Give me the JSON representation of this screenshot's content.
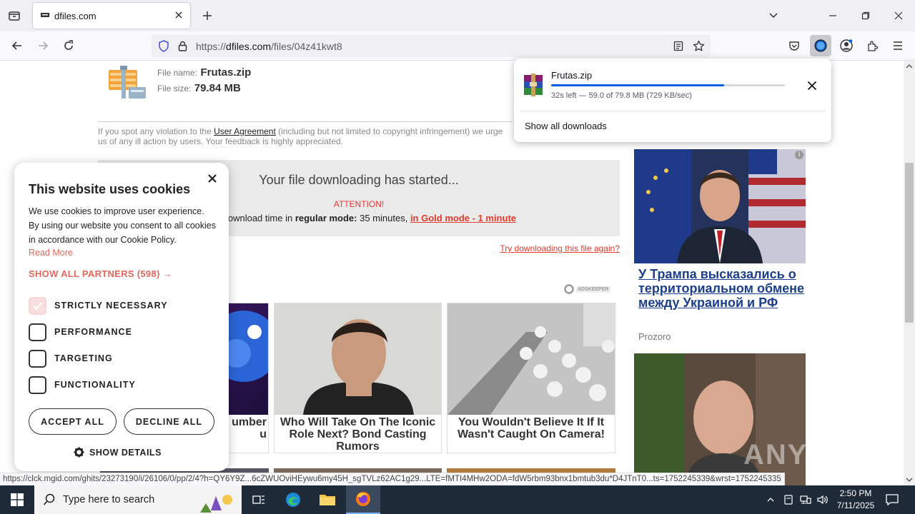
{
  "browser": {
    "tab_title": "dfiles.com",
    "url_prefix": "https://",
    "url_host": "dfiles.com",
    "url_path": "/files/04z41kwt8"
  },
  "file": {
    "name_label": "File name:",
    "name": "Frutas.zip",
    "size_label": "File size:",
    "size": "79.84 MB"
  },
  "violation": {
    "text_before": "If you spot any violation to the ",
    "link": "User Agreement",
    "text_after": " (including but not limited to copyright infringement) we urge",
    "line2": "us of any ill action by users. Your feedback is highly appreciated."
  },
  "download_box": {
    "heading": "Your file downloading has started...",
    "attention": "ATTENTION!",
    "avg_prefix": "rage download time in ",
    "mode": "regular mode:",
    "avg_time": " 35 minutes, ",
    "gold_link": "in Gold mode - 1 minute"
  },
  "retry_link": "Try downloading this file again?",
  "adskeeper": "ADSKEEPER",
  "ads": [
    {
      "caption": "umber\nu"
    },
    {
      "caption": "Who Will Take On The Iconic Role Next? Bond Casting Rumors"
    },
    {
      "caption": "You Wouldn't Believe It If It Wasn't Caught On Camera!"
    }
  ],
  "news": {
    "title": "У Трампа высказались о территориальном обмене между Украиной и РФ",
    "source": "Prozoro"
  },
  "cookie": {
    "title": "This website uses cookies",
    "description": "We use cookies to improve user experience. By using our website you consent to all cookies in accordance with our Cookie Policy.",
    "read_more": "Read More",
    "partners": "SHOW ALL PARTNERS (598) →",
    "options": [
      "STRICTLY NECESSARY",
      "PERFORMANCE",
      "TARGETING",
      "FUNCTIONALITY"
    ],
    "accept": "ACCEPT ALL",
    "decline": "DECLINE ALL",
    "details": "SHOW DETAILS"
  },
  "downloads_panel": {
    "filename": "Frutas.zip",
    "status": "32s left — 59.0 of 79.8 MB (729 KB/sec)",
    "progress": 0.739,
    "show_all": "Show all downloads"
  },
  "status_url": "https://clck.mgid.com/ghits/23273190/i/26106/0/pp/2/4?h=QY6Y9Z...6cZWUOviHEywu6my45H_sgTVLz62AC1g29...LTE=fMTI4MHw2ODA=fdW5rbm93bnx1bmtub3du*D4JTnT0...ts=1752245339&wrst=1752245335",
  "watermark": "ANY.RUN",
  "taskbar": {
    "search_placeholder": "Type here to search",
    "time": "2:50 PM",
    "date": "7/11/2025"
  },
  "colors": {
    "accent_red": "#e03a2c",
    "cookie_accent": "#e0685d",
    "news_link": "#1b3f8b",
    "progress": "#0061e0"
  }
}
